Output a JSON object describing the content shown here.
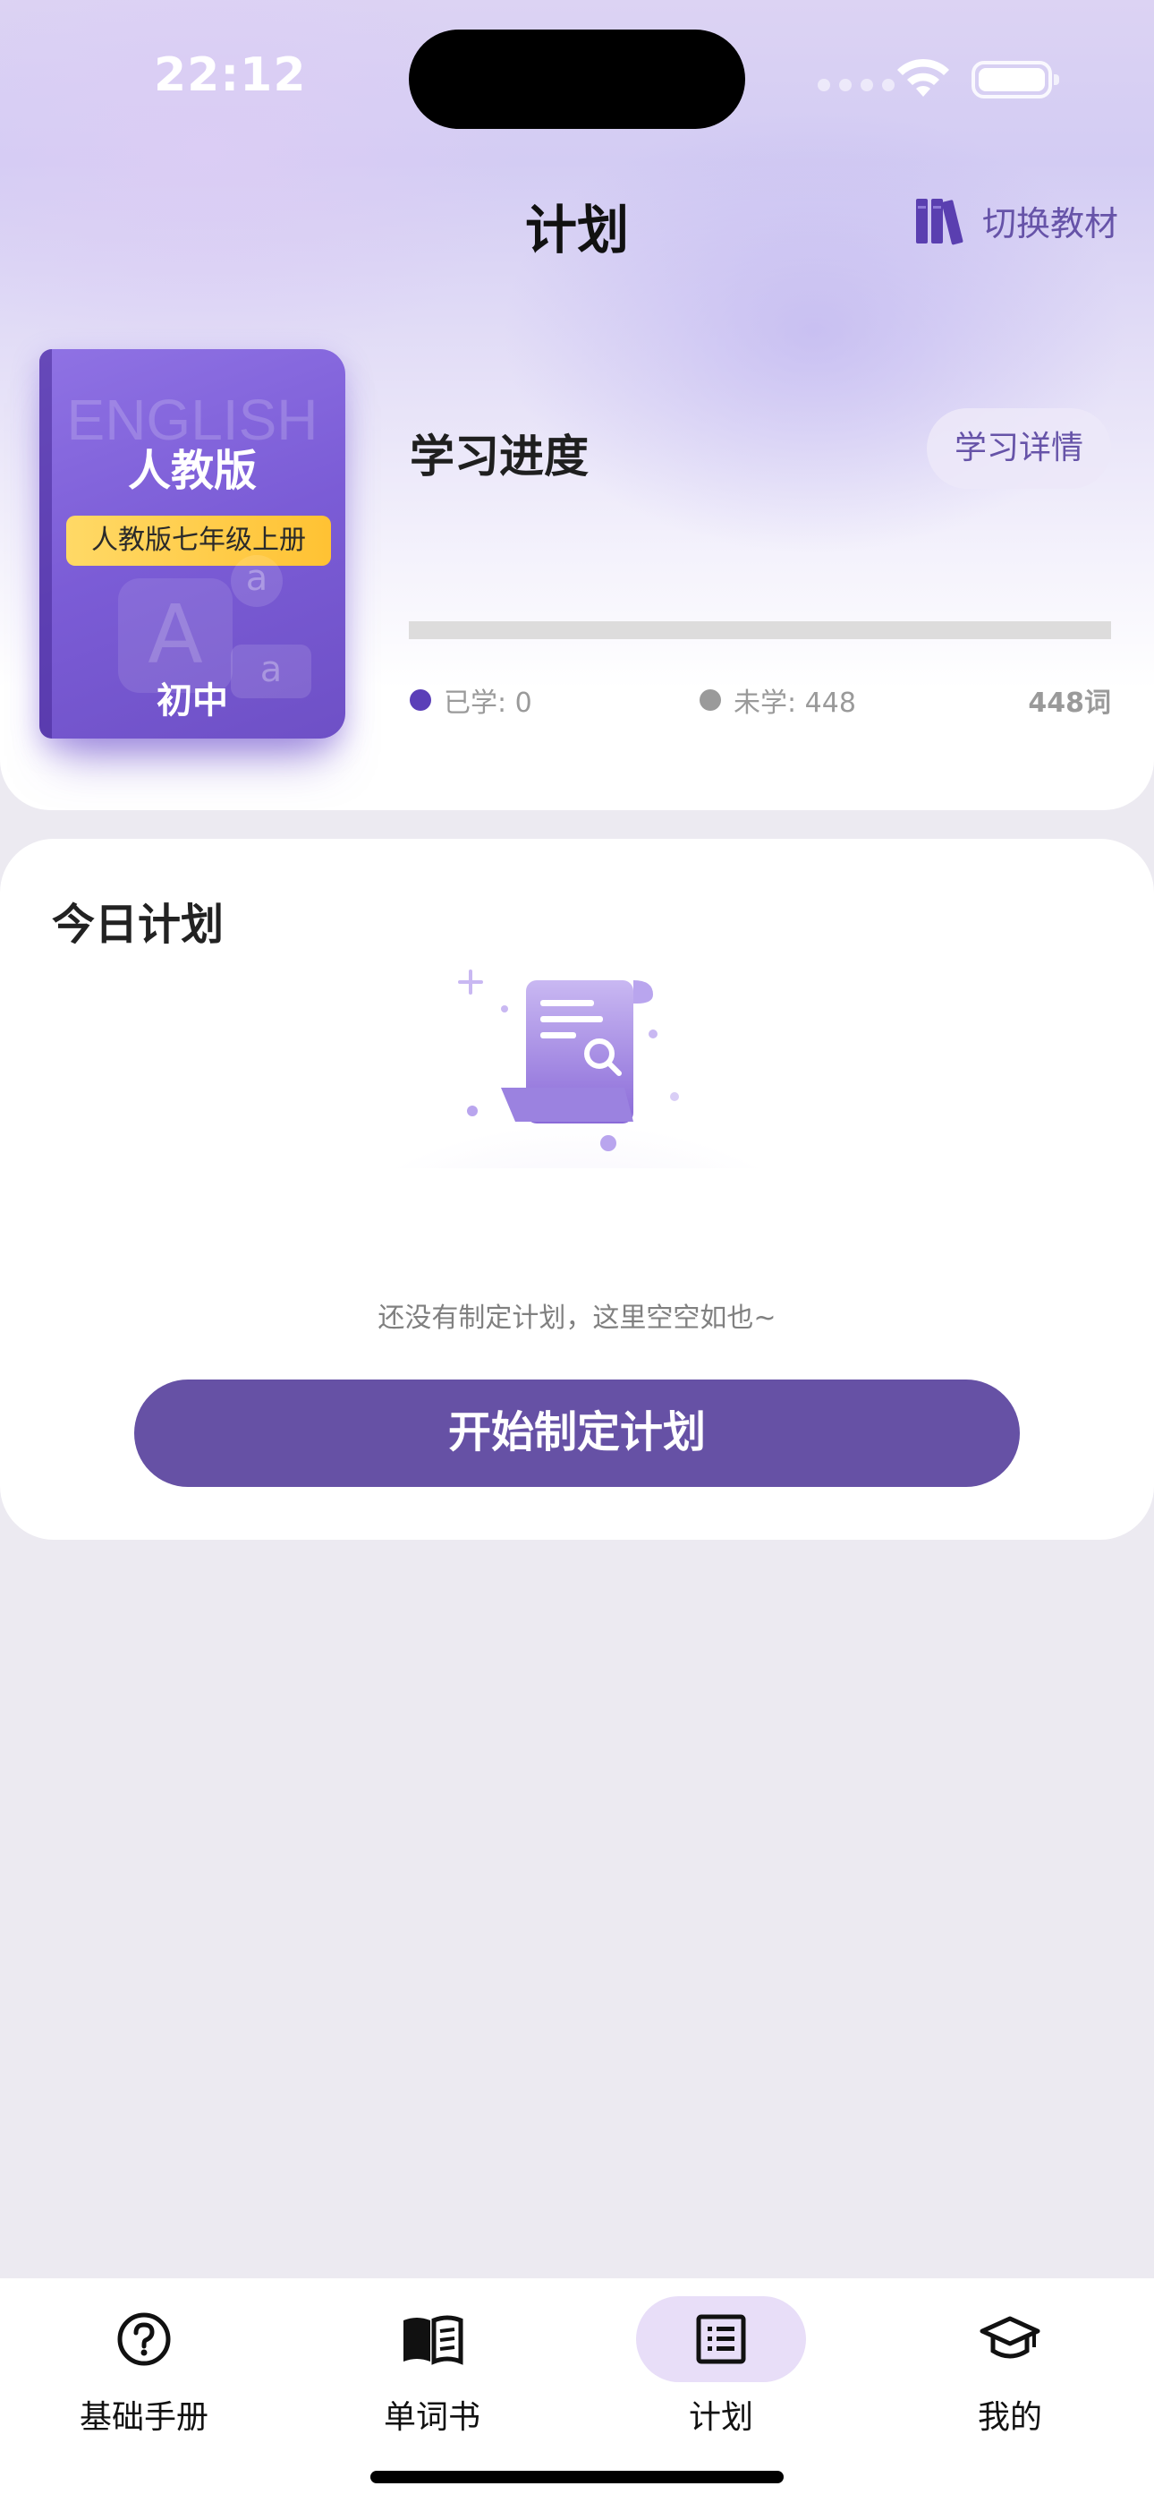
{
  "status_bar": {
    "time": "22:12"
  },
  "nav": {
    "title": "计划",
    "switch_label": "切换教材"
  },
  "book": {
    "watermark": "ENGLISH",
    "publisher": "人教版",
    "grade": "人教版七年级上册",
    "level": "初中",
    "deco_big": "A",
    "deco_small": "a"
  },
  "progress": {
    "title": "学习进度",
    "detail_button": "学习详情",
    "learned_label": "已学: 0",
    "unlearned_label": "未学: 448",
    "total_label": "448词",
    "learned": 0,
    "total": 448,
    "colors": {
      "learned": "#5B3FB8",
      "unlearned": "#9A9A9A"
    }
  },
  "today_plan": {
    "title": "今日计划",
    "empty_text": "还没有制定计划，这里空空如也~",
    "start_button": "开始制定计划"
  },
  "tabbar": {
    "items": [
      {
        "label": "基础手册",
        "icon": "question-circle-icon",
        "active": false
      },
      {
        "label": "单词书",
        "icon": "open-book-icon",
        "active": false
      },
      {
        "label": "计划",
        "icon": "list-icon",
        "active": true
      },
      {
        "label": "我的",
        "icon": "graduation-cap-icon",
        "active": false
      }
    ]
  },
  "theme": {
    "accent": "#6651A5",
    "tab_active_bg": "#E8DEF8"
  }
}
